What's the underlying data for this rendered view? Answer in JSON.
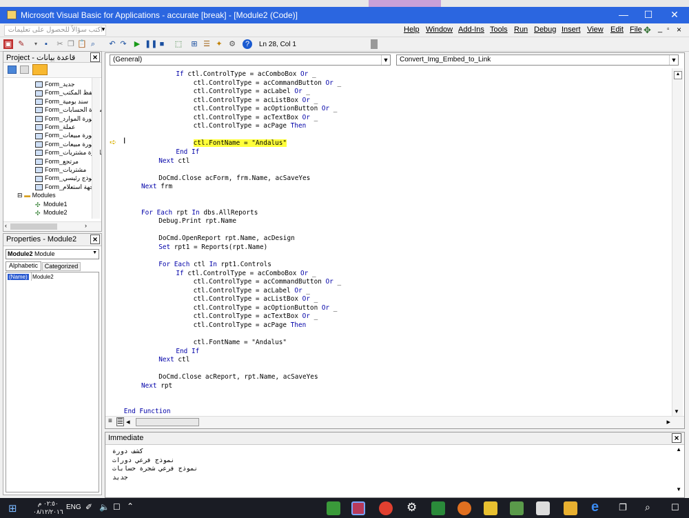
{
  "window": {
    "title": "Microsoft Visual Basic for Applications - accurate [break] - [Module2 (Code)]",
    "buttons": [
      "—",
      "☐",
      "✕"
    ]
  },
  "menubar": {
    "left_combo": "اكتب سؤالاً للحصول على تعليمات",
    "items": [
      "Help",
      "Window",
      "Add-Ins",
      "Tools",
      "Run",
      "Debug",
      "Insert",
      "View",
      "Edit",
      "File"
    ],
    "mdi_buttons": [
      "_",
      "▫",
      "×"
    ]
  },
  "toolbar": {
    "position": "Ln 28, Col 1"
  },
  "project_panel": {
    "title": "Project - قاعدة بيانات",
    "forms": [
      {
        "name": "Form_جديد"
      },
      {
        "name": "Form_حفظ المكتب"
      },
      {
        "name": "Form_سند يومية"
      },
      {
        "name": "Form_شجرة الحسابات"
      },
      {
        "name": "Form_صورة الموارد"
      },
      {
        "name": "Form_عملة"
      },
      {
        "name": "Form_فاتورة مبيعات"
      },
      {
        "name": "Form_فاتورة مبيعات"
      },
      {
        "name": "Form_فاتورة مشتريات"
      },
      {
        "name": "Form_مرتجع"
      },
      {
        "name": "Form_مشتريات"
      },
      {
        "name": "Form_نموذج رئيسي"
      },
      {
        "name": "Form_واجهة استعلام"
      }
    ],
    "modules_label": "Modules",
    "modules": [
      "Module1",
      "Module2"
    ]
  },
  "properties_panel": {
    "title": "Properties - Module2",
    "object": "Module2",
    "object_type": "Module",
    "tabs": [
      "Alphabetic",
      "Categorized"
    ],
    "row_name": "(Name)",
    "row_value": "Module2"
  },
  "code_window": {
    "object_dropdown": "(General)",
    "proc_dropdown": "Convert_Img_Embed_to_Link",
    "lines": [
      {
        "indent": 8,
        "text": "If ctl.ControlType = acComboBox Or _"
      },
      {
        "indent": 12,
        "text": "ctl.ControlType = acCommandButton Or _"
      },
      {
        "indent": 12,
        "text": "ctl.ControlType = acLabel Or _"
      },
      {
        "indent": 12,
        "text": "ctl.ControlType = acListBox Or _"
      },
      {
        "indent": 12,
        "text": "ctl.ControlType = acOptionButton Or _"
      },
      {
        "indent": 12,
        "text": "ctl.ControlType = acTextBox Or _"
      },
      {
        "indent": 12,
        "text": "ctl.ControlType = acPage Then"
      },
      {
        "indent": 0,
        "text": ""
      },
      {
        "indent": 12,
        "text": "ctl.FontName = \"Andalus\"",
        "highlight": true
      },
      {
        "indent": 8,
        "text": "End If"
      },
      {
        "indent": 4,
        "text": "Next ctl"
      },
      {
        "indent": 0,
        "text": ""
      },
      {
        "indent": 4,
        "text": "DoCmd.Close acForm, frm.Name, acSaveYes"
      },
      {
        "indent": 0,
        "text": "Next frm"
      },
      {
        "indent": 0,
        "text": ""
      },
      {
        "indent": 0,
        "text": ""
      },
      {
        "indent": 0,
        "text": "For Each rpt In dbs.AllReports"
      },
      {
        "indent": 4,
        "text": "Debug.Print rpt.Name"
      },
      {
        "indent": 0,
        "text": ""
      },
      {
        "indent": 4,
        "text": "DoCmd.OpenReport rpt.Name, acDesign"
      },
      {
        "indent": 4,
        "text": "Set rpt1 = Reports(rpt.Name)"
      },
      {
        "indent": 0,
        "text": ""
      },
      {
        "indent": 4,
        "text": "For Each ctl In rpt1.Controls"
      },
      {
        "indent": 8,
        "text": "If ctl.ControlType = acComboBox Or _"
      },
      {
        "indent": 12,
        "text": "ctl.ControlType = acCommandButton Or _"
      },
      {
        "indent": 12,
        "text": "ctl.ControlType = acLabel Or _"
      },
      {
        "indent": 12,
        "text": "ctl.ControlType = acListBox Or _"
      },
      {
        "indent": 12,
        "text": "ctl.ControlType = acOptionButton Or _"
      },
      {
        "indent": 12,
        "text": "ctl.ControlType = acTextBox Or _"
      },
      {
        "indent": 12,
        "text": "ctl.ControlType = acPage Then"
      },
      {
        "indent": 0,
        "text": ""
      },
      {
        "indent": 12,
        "text": "ctl.FontName = \"Andalus\""
      },
      {
        "indent": 8,
        "text": "End If"
      },
      {
        "indent": 4,
        "text": "Next ctl"
      },
      {
        "indent": 0,
        "text": ""
      },
      {
        "indent": 4,
        "text": "DoCmd.Close acReport, rpt.Name, acSaveYes"
      },
      {
        "indent": 0,
        "text": "Next rpt"
      },
      {
        "indent": 0,
        "text": ""
      },
      {
        "indent": 0,
        "text": ""
      },
      {
        "indent": -4,
        "text": "End Function"
      }
    ]
  },
  "immediate": {
    "title": "Immediate",
    "lines": [
      "كشف دورة",
      "نموذج فرعي دورات",
      "نموذج فرعي شجرة حسابات",
      "جديد"
    ]
  },
  "taskbar": {
    "clock_time": "٠٢:٥٠ م",
    "clock_date": "٠٨/١٢/٢٠١٦",
    "language": "ENG"
  },
  "colors": {
    "titlebar": "#2b66e0",
    "keyword": "#0000a8",
    "highlight": "#ffff3a",
    "taskbar": "#1a1c24"
  }
}
